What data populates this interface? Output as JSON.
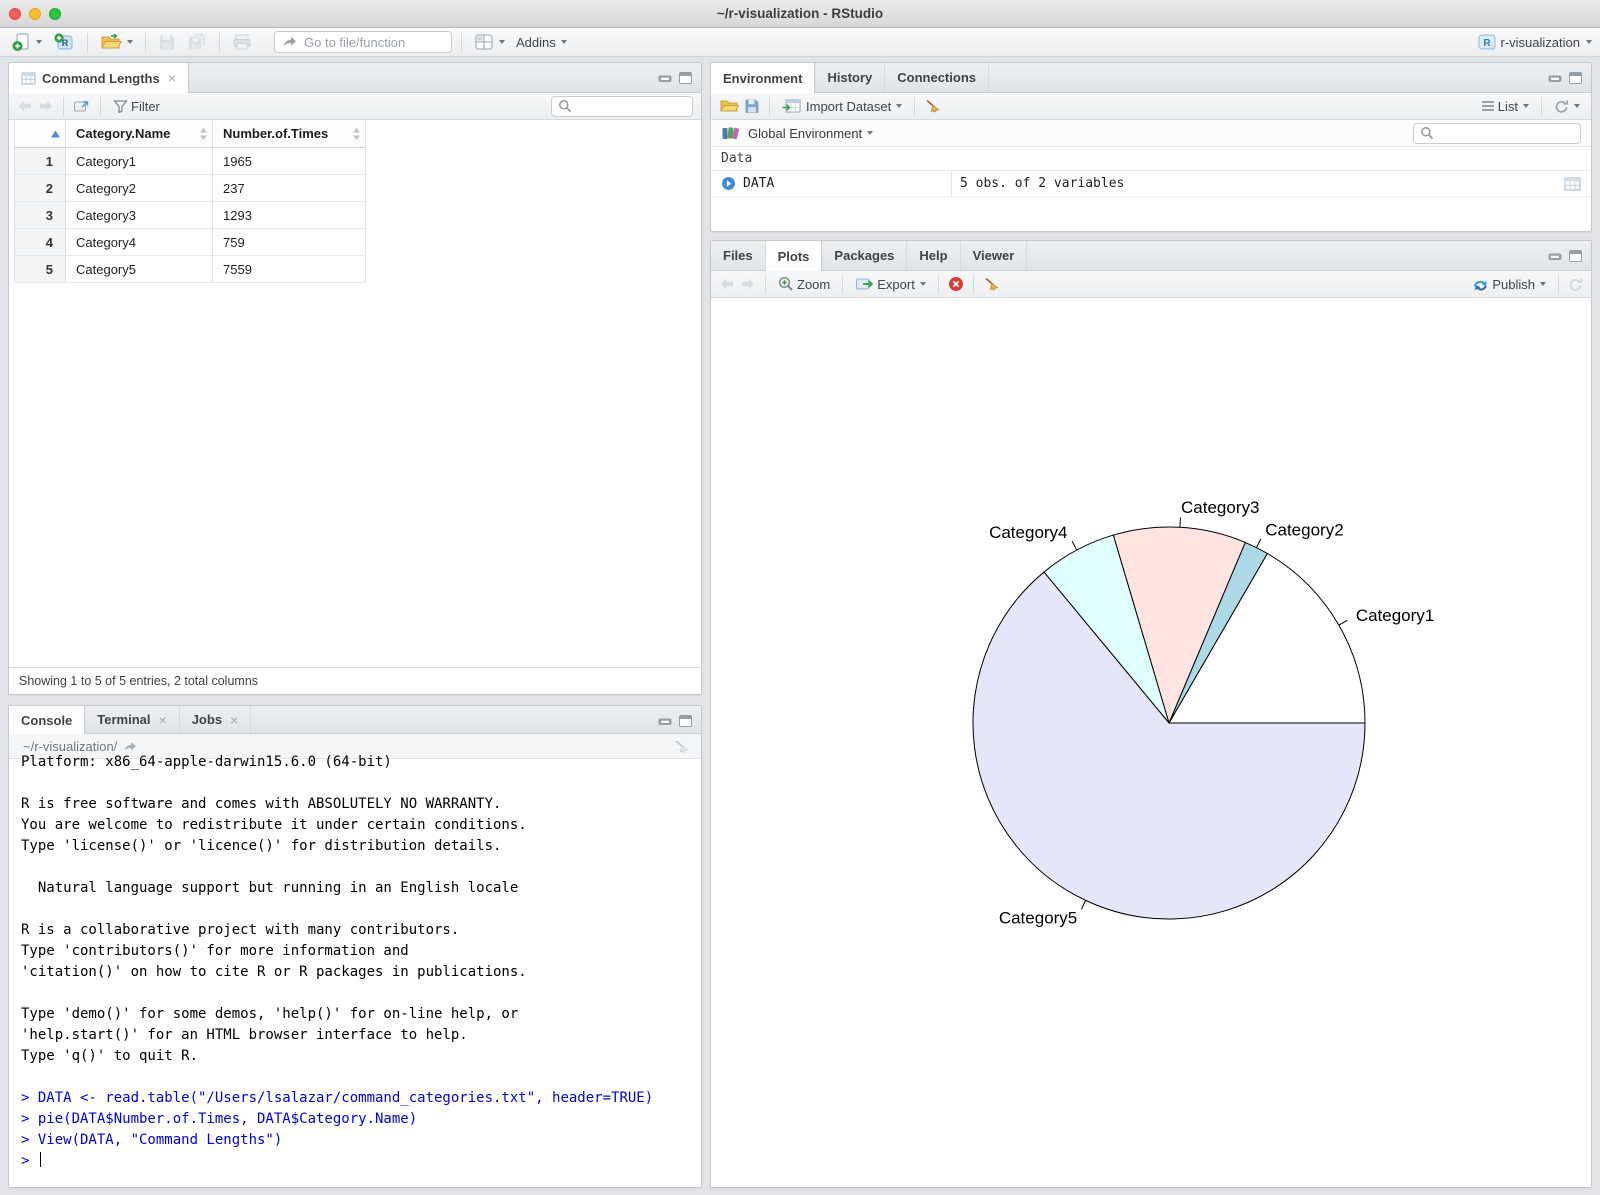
{
  "window": {
    "title": "~/r-visualization - RStudio"
  },
  "main_toolbar": {
    "goto_placeholder": "Go to file/function",
    "addins_label": "Addins",
    "project_label": "r-visualization"
  },
  "data_viewer": {
    "tab_label": "Command Lengths",
    "filter_label": "Filter",
    "table": {
      "headers": [
        "Category.Name",
        "Number.of.Times"
      ],
      "rows": [
        [
          "1",
          "Category1",
          "1965"
        ],
        [
          "2",
          "Category2",
          "237"
        ],
        [
          "3",
          "Category3",
          "1293"
        ],
        [
          "4",
          "Category4",
          "759"
        ],
        [
          "5",
          "Category5",
          "7559"
        ]
      ]
    },
    "status": "Showing 1 to 5 of 5 entries, 2 total columns"
  },
  "environment": {
    "tabs": [
      "Environment",
      "History",
      "Connections"
    ],
    "import_label": "Import Dataset",
    "list_label": "List",
    "scope_label": "Global Environment",
    "section_label": "Data",
    "object": {
      "name": "DATA",
      "summary": "5 obs. of 2 variables"
    }
  },
  "plots": {
    "tabs": [
      "Files",
      "Plots",
      "Packages",
      "Help",
      "Viewer"
    ],
    "zoom_label": "Zoom",
    "export_label": "Export",
    "publish_label": "Publish"
  },
  "console": {
    "tabs": [
      "Console",
      "Terminal",
      "Jobs"
    ],
    "working_dir": "~/r-visualization/",
    "prompt": ">",
    "input_color": "#0000E6",
    "lines": [
      {
        "type": "output",
        "text": "Platform: x86_64-apple-darwin15.6.0 (64-bit)"
      },
      {
        "type": "output",
        "text": ""
      },
      {
        "type": "output",
        "text": "R is free software and comes with ABSOLUTELY NO WARRANTY."
      },
      {
        "type": "output",
        "text": "You are welcome to redistribute it under certain conditions."
      },
      {
        "type": "output",
        "text": "Type 'license()' or 'licence()' for distribution details."
      },
      {
        "type": "output",
        "text": ""
      },
      {
        "type": "output",
        "text": "  Natural language support but running in an English locale"
      },
      {
        "type": "output",
        "text": ""
      },
      {
        "type": "output",
        "text": "R is a collaborative project with many contributors."
      },
      {
        "type": "output",
        "text": "Type 'contributors()' for more information and"
      },
      {
        "type": "output",
        "text": "'citation()' on how to cite R or R packages in publications."
      },
      {
        "type": "output",
        "text": ""
      },
      {
        "type": "output",
        "text": "Type 'demo()' for some demos, 'help()' for on-line help, or"
      },
      {
        "type": "output",
        "text": "'help.start()' for an HTML browser interface to help."
      },
      {
        "type": "output",
        "text": "Type 'q()' to quit R."
      },
      {
        "type": "output",
        "text": ""
      },
      {
        "type": "input",
        "text": "DATA <- read.table(\"/Users/lsalazar/command_categories.txt\", header=TRUE)"
      },
      {
        "type": "input",
        "text": "pie(DATA$Number.of.Times, DATA$Category.Name)"
      },
      {
        "type": "input",
        "text": "View(DATA, \"Command Lengths\")"
      }
    ]
  },
  "chart_data": {
    "type": "pie",
    "categories": [
      "Category1",
      "Category2",
      "Category3",
      "Category4",
      "Category5"
    ],
    "values": [
      1965,
      237,
      1293,
      759,
      7559
    ],
    "colors": [
      "#FFFFFF",
      "#ADD8E6",
      "#FFE4E1",
      "#E0FFFF",
      "#E6E6FA"
    ],
    "stroke_color": "#000000",
    "label_color": "#000000",
    "start_angle_deg": 0,
    "direction": "counterclockwise",
    "title": "",
    "legend": "none"
  }
}
